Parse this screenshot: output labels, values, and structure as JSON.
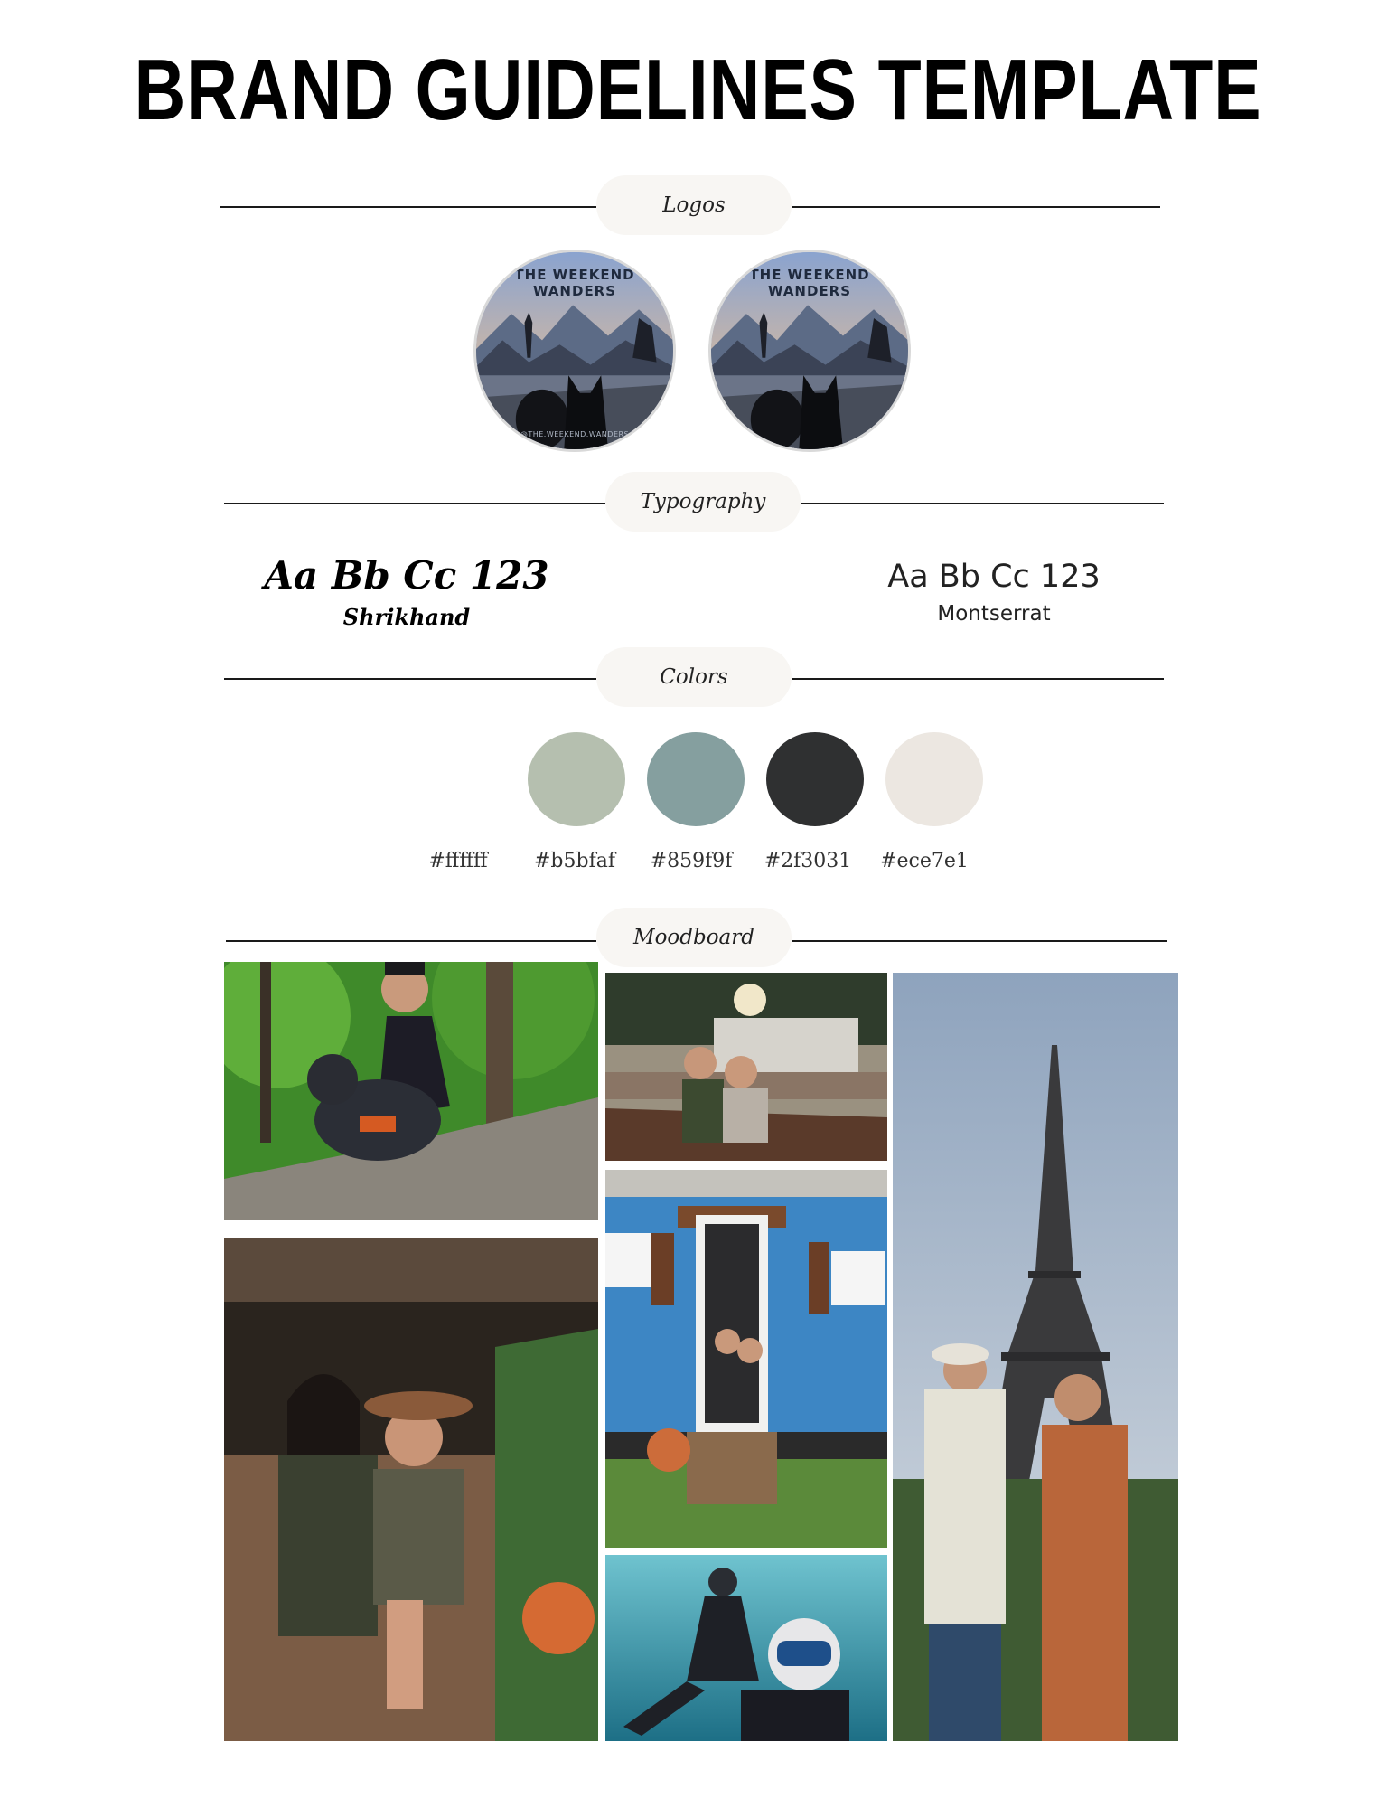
{
  "title": "BRAND GUIDELINES TEMPLATE",
  "sections": {
    "logos": "Logos",
    "typography": "Typography",
    "colors": "Colors",
    "moodboard": "Moodboard"
  },
  "logos": [
    {
      "text": "THE WEEKEND WANDERS",
      "handle": "@THE.WEEKEND.WANDERS"
    },
    {
      "text": "THE WEEKEND WANDERS",
      "handle": ""
    }
  ],
  "typography": {
    "primary": {
      "sample": "Aa Bb Cc 123",
      "name": "Shrikhand"
    },
    "secondary": {
      "sample": "Aa Bb Cc 123",
      "name": "Montserrat"
    }
  },
  "colors": {
    "swatches": [
      "#b5bfaf",
      "#859f9f",
      "#2f3031",
      "#ece7e1"
    ],
    "hex_labels": [
      "#ffffff",
      "#b5bfaf",
      "#859f9f",
      "#2f3031",
      "#ece7e1"
    ]
  }
}
